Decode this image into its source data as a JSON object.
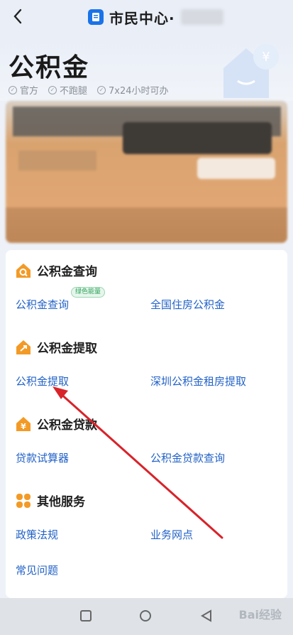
{
  "header": {
    "back_icon": "chevron-left-icon",
    "app_icon": "document-icon",
    "title": "市民中心·"
  },
  "hero": {
    "title": "公积金",
    "badges": [
      "官方",
      "不跑腿",
      "7x24小时可办"
    ]
  },
  "sections": [
    {
      "title": "公积金查询",
      "icon": "house-search-icon",
      "links": [
        "公积金查询",
        "全国住房公积金"
      ],
      "tag": "绿色能量"
    },
    {
      "title": "公积金提取",
      "icon": "house-withdraw-icon",
      "links": [
        "公积金提取",
        "深圳公积金租房提取"
      ]
    },
    {
      "title": "公积金贷款",
      "icon": "house-loan-icon",
      "links": [
        "贷款试算器",
        "公积金贷款查询"
      ]
    },
    {
      "title": "其他服务",
      "icon": "grid-flower-icon",
      "links": [
        "政策法规",
        "业务网点",
        "常见问题"
      ]
    }
  ],
  "colors": {
    "accent": "#f39a26",
    "link": "#2262c7",
    "annotation": "#d8232a"
  },
  "watermark": "Bai经验"
}
